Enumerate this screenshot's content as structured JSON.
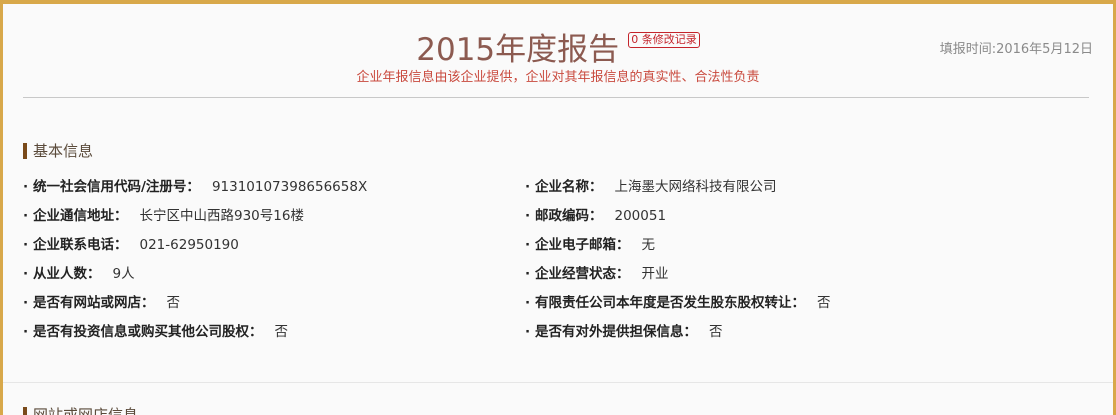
{
  "header": {
    "title": "2015年度报告",
    "badge": "0 条修改记录",
    "subtitle": "企业年报信息由该企业提供，企业对其年报信息的真实性、合法性负责",
    "fill_date": "填报时间:2016年5月12日"
  },
  "basic_info": {
    "section_title": "基本信息",
    "rows": [
      {
        "left": {
          "label": "统一社会信用代码/注册号：",
          "value": "91310107398656658X"
        },
        "right": {
          "label": "企业名称：",
          "value": "上海墨大网络科技有限公司"
        }
      },
      {
        "left": {
          "label": "企业通信地址：",
          "value": "长宁区中山西路930号16楼"
        },
        "right": {
          "label": "邮政编码：",
          "value": "200051"
        }
      },
      {
        "left": {
          "label": "企业联系电话：",
          "value": "021-62950190"
        },
        "right": {
          "label": "企业电子邮箱：",
          "value": "无"
        }
      },
      {
        "left": {
          "label": "从业人数：",
          "value": "9人"
        },
        "right": {
          "label": "企业经营状态：",
          "value": "开业"
        }
      },
      {
        "left": {
          "label": "是否有网站或网店：",
          "value": "否"
        },
        "right": {
          "label": "有限责任公司本年度是否发生股东股权转让：",
          "value": "否"
        }
      },
      {
        "left": {
          "label": "是否有投资信息或购买其他公司股权：",
          "value": "否"
        },
        "right": {
          "label": "是否有对外提供担保信息：",
          "value": "否"
        }
      }
    ]
  },
  "next_section": {
    "section_title": "网站或网店信息"
  },
  "colors": {
    "border": "#d8a84a",
    "title": "#8c5a50",
    "accent_red": "#c4242b"
  }
}
